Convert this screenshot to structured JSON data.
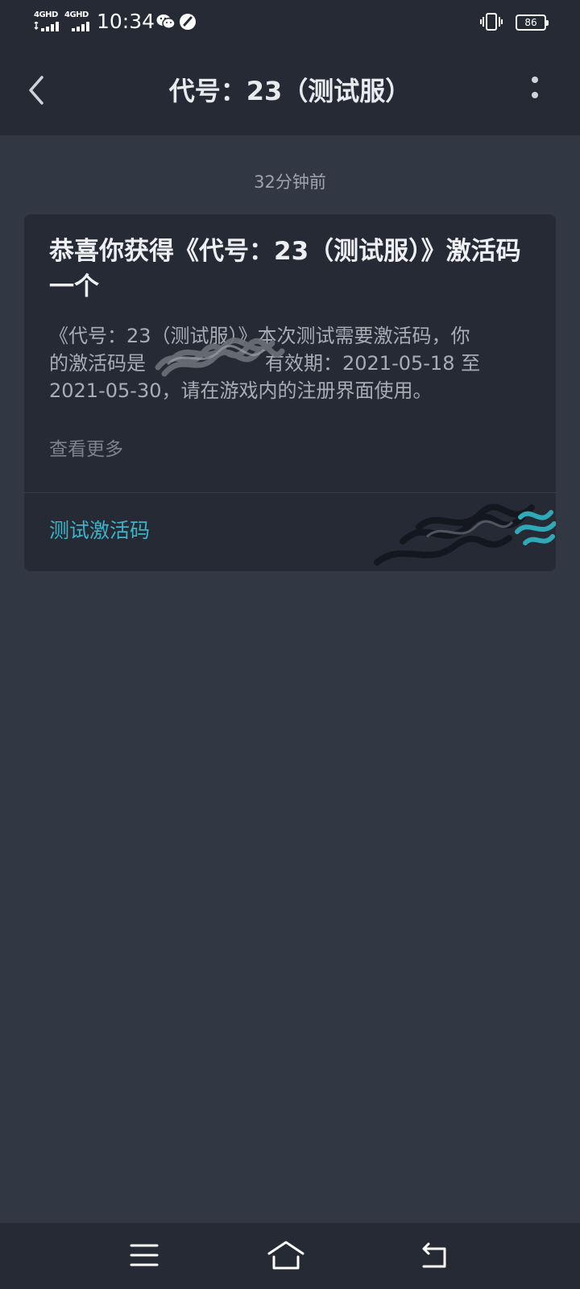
{
  "status_bar": {
    "net1": "4GHD",
    "net2": "4GHD",
    "time": "10:34",
    "battery": "86",
    "icons": [
      "signal-bars-icon",
      "wechat-icon",
      "speed-icon",
      "vibrate-icon",
      "battery-icon"
    ]
  },
  "nav": {
    "back_icon": "chevron-left-icon",
    "title": "代号：23（测试服）",
    "more_icon": "more-vertical-icon"
  },
  "message": {
    "time": "32分钟前",
    "title": "恭喜你获得《代号：23（测试服）》激活码一个",
    "body_line1": "《代号：23（测试服）》本次测试需要激活码，你",
    "body_line2_prefix": "的激活码是",
    "body_line2_suffix": "有效期：2021-05-18 至",
    "body_line3": "2021-05-30，请在游戏内的注册界面使用。",
    "more_label": "查看更多",
    "link_label": "测试激活码"
  },
  "bottom_nav": {
    "icons": [
      "menu-icon",
      "home-icon",
      "back-icon"
    ]
  },
  "colors": {
    "background": "#323744",
    "bar": "#262a35",
    "accent": "#3bb3c9"
  }
}
